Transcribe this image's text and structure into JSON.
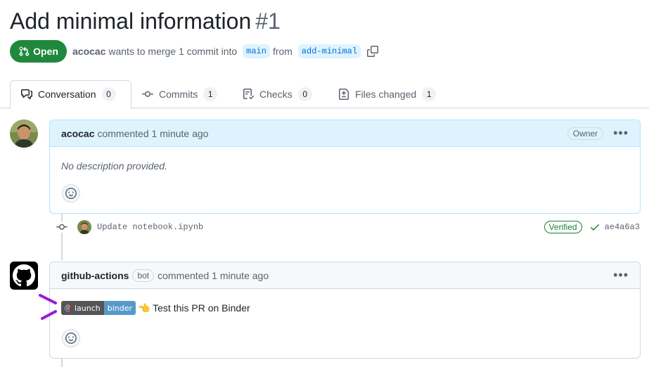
{
  "pr": {
    "title": "Add minimal information",
    "number": "#1",
    "state_label": "Open",
    "author": "acocac",
    "merge_text": "wants to merge 1 commit into",
    "base_branch": "main",
    "from_text": "from",
    "head_branch": "add-minimal"
  },
  "tabs": [
    {
      "label": "Conversation",
      "count": "0",
      "icon": "comment-discussion-icon"
    },
    {
      "label": "Commits",
      "count": "1",
      "icon": "git-commit-icon"
    },
    {
      "label": "Checks",
      "count": "0",
      "icon": "checklist-icon"
    },
    {
      "label": "Files changed",
      "count": "1",
      "icon": "file-diff-icon"
    }
  ],
  "comment1": {
    "author": "acocac",
    "action": "commented 1 minute ago",
    "role_badge": "Owner",
    "body": "No description provided."
  },
  "commit": {
    "message": "Update notebook.ipynb",
    "verified_label": "Verified",
    "sha": "ae4a6a3"
  },
  "comment2": {
    "author": "github-actions",
    "bot_badge": "bot",
    "action": "commented 1 minute ago",
    "badge_left": "launch",
    "badge_right": "binder",
    "body_text": "👈 Test this PR on Binder"
  },
  "colors": {
    "open_green": "#1f883d",
    "link_blue": "#0969da",
    "annotation_purple": "#9a17e0"
  }
}
